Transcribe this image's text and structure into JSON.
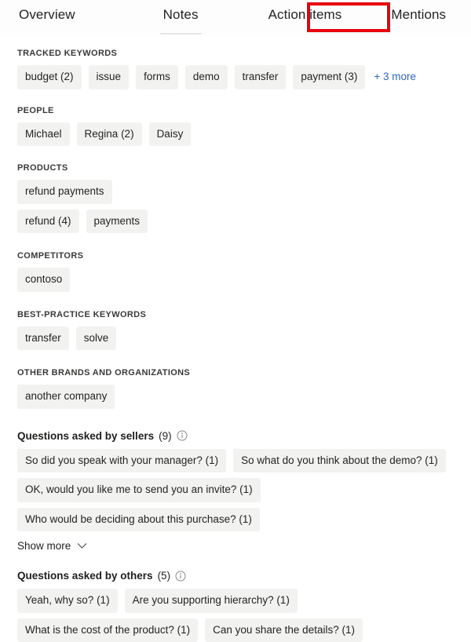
{
  "tabs": [
    {
      "id": "overview",
      "label": "Overview",
      "selected": false
    },
    {
      "id": "notes",
      "label": "Notes",
      "selected": true
    },
    {
      "id": "action-items",
      "label": "Action items",
      "selected": false
    },
    {
      "id": "mentions",
      "label": "Mentions",
      "selected": false
    }
  ],
  "annotation": {
    "target": "Mentions",
    "color": "#e8000d"
  },
  "colors": {
    "chip_bg": "#f2f2f1",
    "link": "#2b66c4",
    "text": "#201f1e",
    "section_title": "#3b3a39",
    "tab_underline": "#e3e7e8",
    "page_bg": "#ffffff"
  },
  "sections": [
    {
      "id": "tracked-keywords",
      "title": "TRACKED KEYWORDS",
      "chips": [
        "budget (2)",
        "issue",
        "forms",
        "demo",
        "transfer",
        "payment (3)"
      ],
      "more_link": "+ 3 more"
    },
    {
      "id": "people",
      "title": "PEOPLE",
      "chips": [
        "Michael",
        "Regina (2)",
        "Daisy"
      ],
      "more_link": null
    },
    {
      "id": "products",
      "title": "PRODUCTS",
      "chips": [
        "refund payments",
        "refund (4)",
        "payments"
      ],
      "more_link": null
    },
    {
      "id": "competitors",
      "title": "COMPETITORS",
      "chips": [
        "contoso"
      ],
      "more_link": null
    },
    {
      "id": "best-practice-keywords",
      "title": "BEST-PRACTICE KEYWORDS",
      "chips": [
        "transfer",
        "solve"
      ],
      "more_link": null
    },
    {
      "id": "other-brands",
      "title": "OTHER BRANDS AND ORGANIZATIONS",
      "chips": [
        "another company"
      ],
      "more_link": null
    }
  ],
  "questions_sellers": {
    "label": "Questions asked by sellers",
    "count": "(9)",
    "info_icon": "info-icon",
    "chips": [
      "So did you speak with your manager? (1)",
      "So what do you think about the demo? (1)",
      "OK, would you like me to send you an invite? (1)",
      "Who would be deciding about this purchase? (1)"
    ],
    "show_more_label": "Show more",
    "chevron_icon": "chevron-down-icon"
  },
  "questions_others": {
    "label": "Questions asked by others",
    "count": "(5)",
    "info_icon": "info-icon",
    "chips": [
      "Yeah, why so? (1)",
      "Are you supporting hierarchy? (1)",
      "What is the cost of the product? (1)",
      "Can you share the details? (1)"
    ]
  }
}
